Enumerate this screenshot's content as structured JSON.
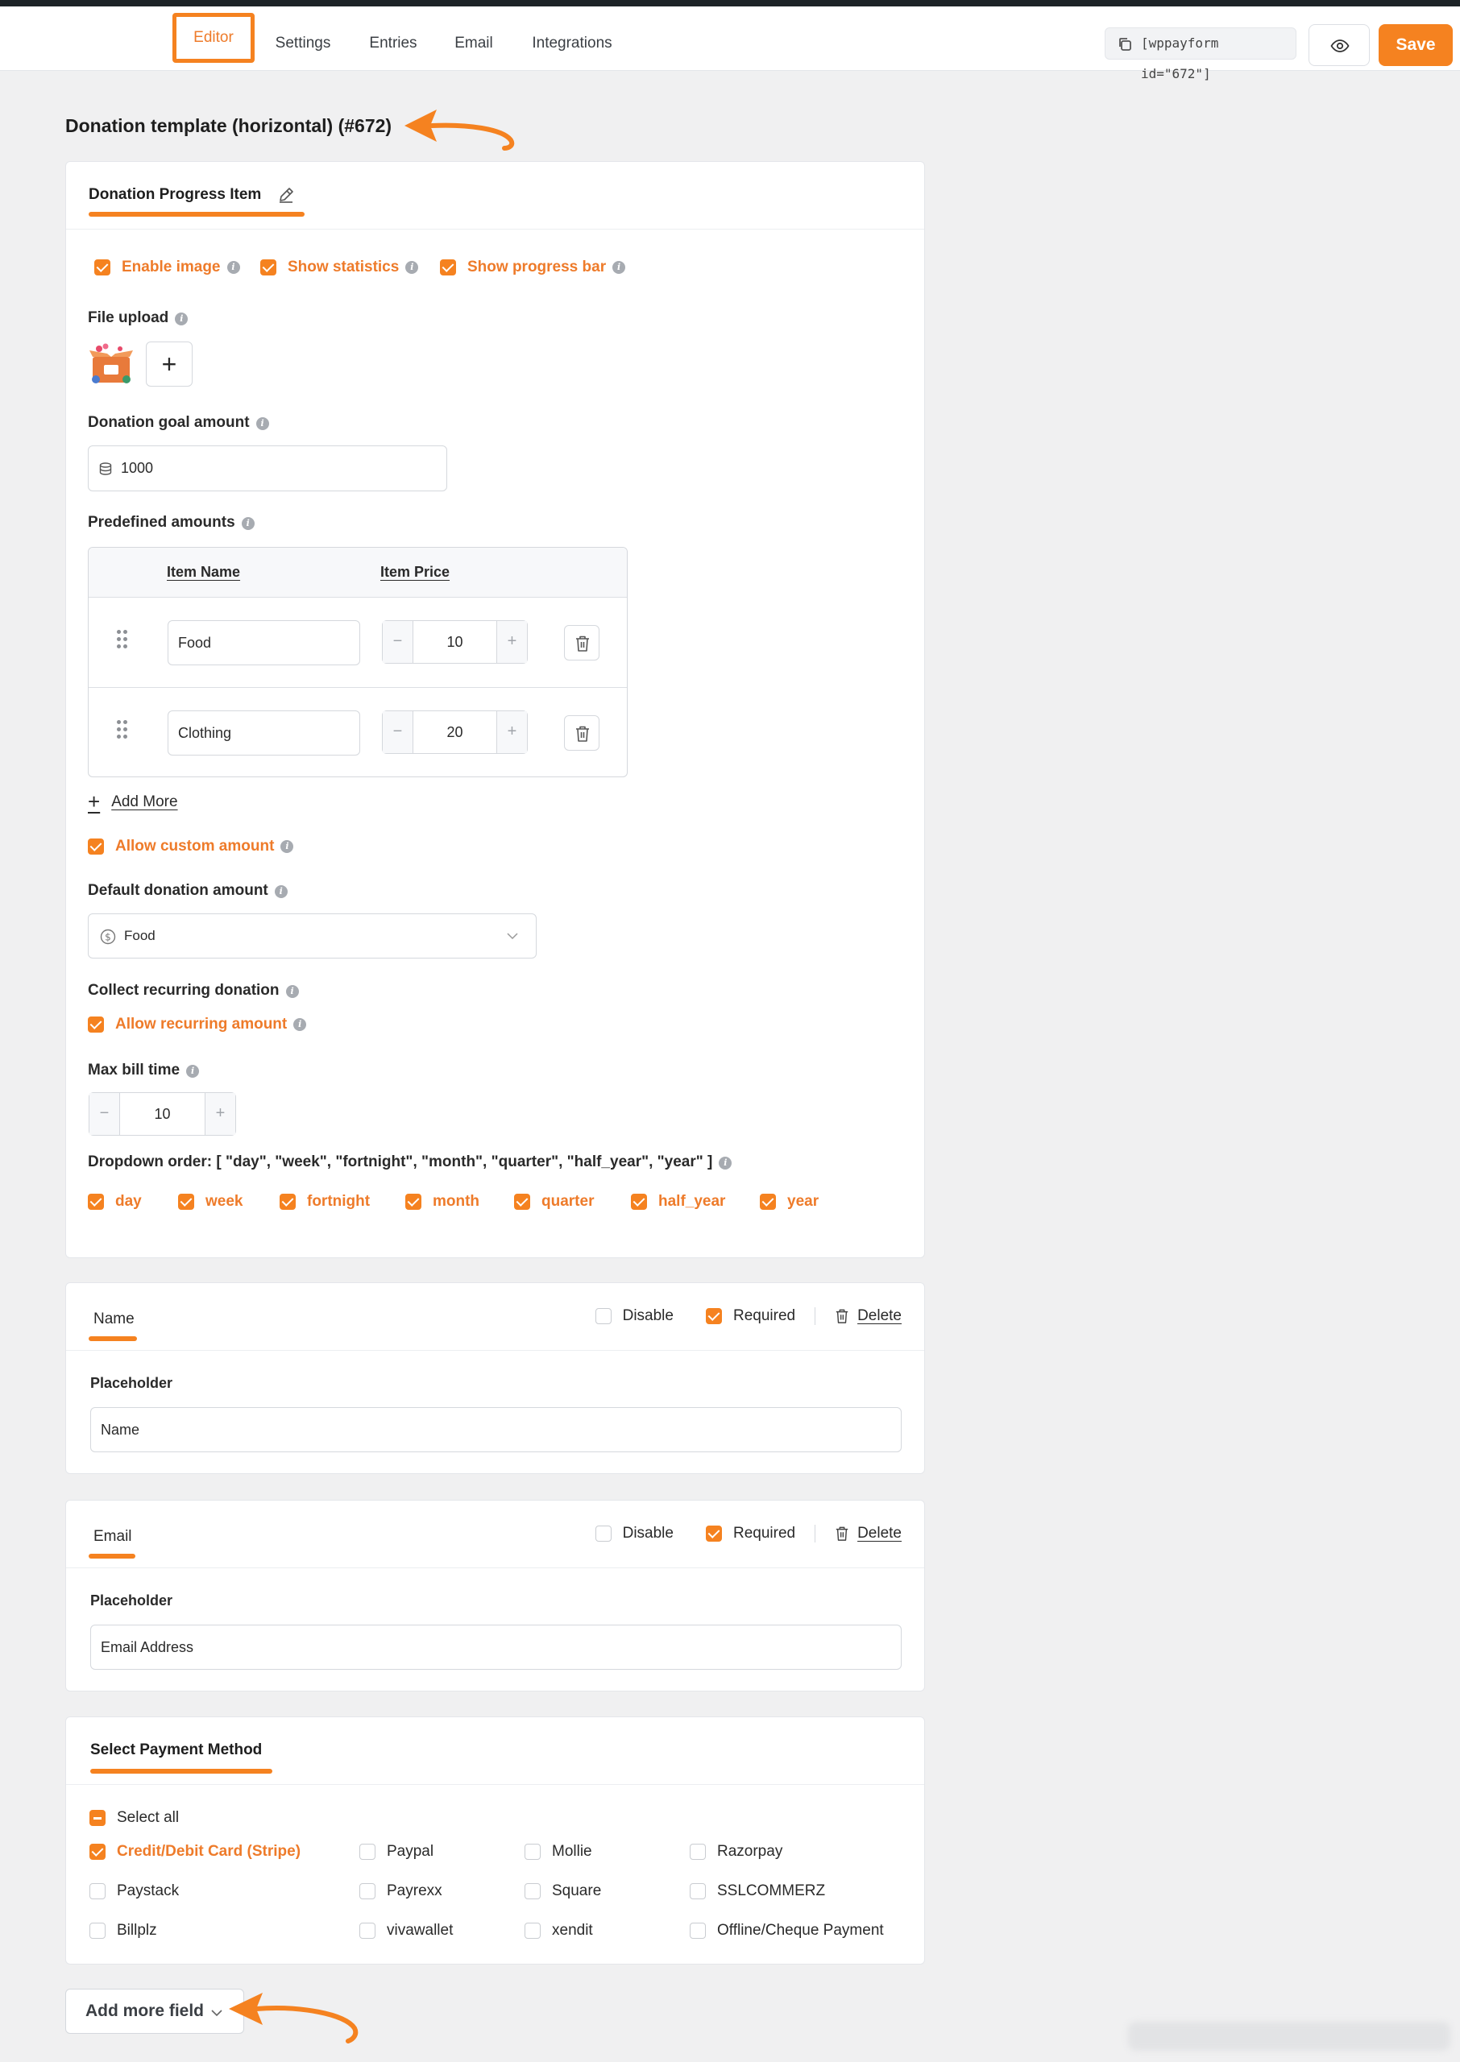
{
  "nav": {
    "tabs": [
      {
        "label": "Editor",
        "active": true
      },
      {
        "label": "Settings"
      },
      {
        "label": "Entries"
      },
      {
        "label": "Email"
      },
      {
        "label": "Integrations"
      }
    ],
    "shortcode": "[wppayform id=\"672\"]",
    "save_label": "Save"
  },
  "page": {
    "title": "Donation template (horizontal) (#672)"
  },
  "donation": {
    "title": "Donation Progress Item",
    "options": [
      "Enable image",
      "Show statistics",
      "Show progress bar"
    ],
    "file_upload_label": "File upload",
    "goal_label": "Donation goal amount",
    "goal_value": "1000",
    "predefined_label": "Predefined amounts",
    "col_name": "Item Name",
    "col_price": "Item Price",
    "items": [
      {
        "name": "Food",
        "price": "10"
      },
      {
        "name": "Clothing",
        "price": "20"
      }
    ],
    "add_more": "Add More",
    "allow_custom": "Allow custom amount",
    "default_label": "Default donation amount",
    "default_value": "Food",
    "recurring_label": "Collect recurring donation",
    "allow_recurring": "Allow recurring amount",
    "max_bill_label": "Max bill time",
    "max_bill_value": "10",
    "dropdown_order_label": "Dropdown order: [ \"day\", \"week\", \"fortnight\", \"month\", \"quarter\", \"half_year\", \"year\" ]",
    "periods": [
      "day",
      "week",
      "fortnight",
      "month",
      "quarter",
      "half_year",
      "year"
    ]
  },
  "name_field": {
    "title": "Name",
    "disable": "Disable",
    "required": "Required",
    "delete": "Delete",
    "placeholder_label": "Placeholder",
    "placeholder_value": "Name"
  },
  "email_field": {
    "title": "Email",
    "disable": "Disable",
    "required": "Required",
    "delete": "Delete",
    "placeholder_label": "Placeholder",
    "placeholder_value": "Email Address"
  },
  "payment": {
    "title": "Select Payment Method",
    "select_all": "Select all",
    "methods": [
      {
        "label": "Credit/Debit Card (Stripe)",
        "checked": true
      },
      {
        "label": "Paypal"
      },
      {
        "label": "Mollie"
      },
      {
        "label": "Razorpay"
      },
      {
        "label": "Paystack"
      },
      {
        "label": "Payrexx"
      },
      {
        "label": "Square"
      },
      {
        "label": "SSLCOMMERZ"
      },
      {
        "label": "Billplz"
      },
      {
        "label": "vivawallet"
      },
      {
        "label": "xendit"
      },
      {
        "label": "Offline/Cheque Payment"
      }
    ]
  },
  "footer": {
    "add_field": "Add more field"
  },
  "colors": {
    "accent": "#f58220",
    "accent_text": "#ee7b2a"
  }
}
